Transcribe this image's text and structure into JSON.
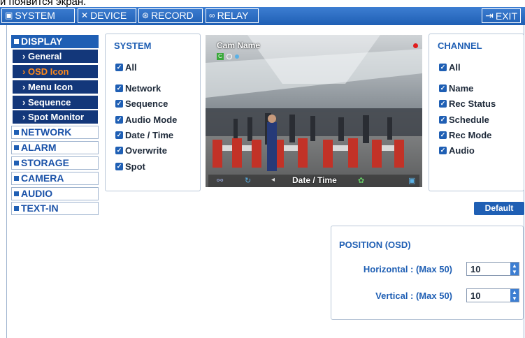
{
  "top_caption": "и появится экран.",
  "topbar": {
    "tabs": [
      {
        "label": "SYSTEM",
        "icon": "monitor-icon"
      },
      {
        "label": "DEVICE",
        "icon": "tools-icon"
      },
      {
        "label": "RECORD",
        "icon": "record-icon"
      },
      {
        "label": "RELAY",
        "icon": "relay-icon"
      }
    ],
    "exit_label": "EXIT"
  },
  "sidebar": {
    "display": "DISPLAY",
    "sub_items": [
      "General",
      "OSD Icon",
      "Menu Icon",
      "Sequence",
      "Spot Monitor"
    ],
    "selected_sub": "OSD Icon",
    "others": [
      "NETWORK",
      "ALARM",
      "STORAGE",
      "CAMERA",
      "AUDIO",
      "TEXT-IN"
    ]
  },
  "system_panel": {
    "title": "SYSTEM",
    "items": [
      "All",
      "Network",
      "Sequence",
      "Audio Mode",
      "Date / Time",
      "Overwrite",
      "Spot"
    ]
  },
  "preview": {
    "cam_name": "Cam Name",
    "date_time": "Date / Time"
  },
  "channel_panel": {
    "title": "CHANNEL",
    "items": [
      "All",
      "Name",
      "Rec Status",
      "Schedule",
      "Rec Mode",
      "Audio"
    ]
  },
  "default_label": "Default",
  "position": {
    "title": "POSITION (OSD)",
    "horizontal_label": "Horizontal : (Max 50)",
    "horizontal_value": "10",
    "vertical_label": "Vertical : (Max 50)",
    "vertical_value": "10"
  },
  "colors": {
    "accent": "#1f5fb4",
    "selected": "#ff8a1c",
    "submenu_bg": "#13377a"
  }
}
